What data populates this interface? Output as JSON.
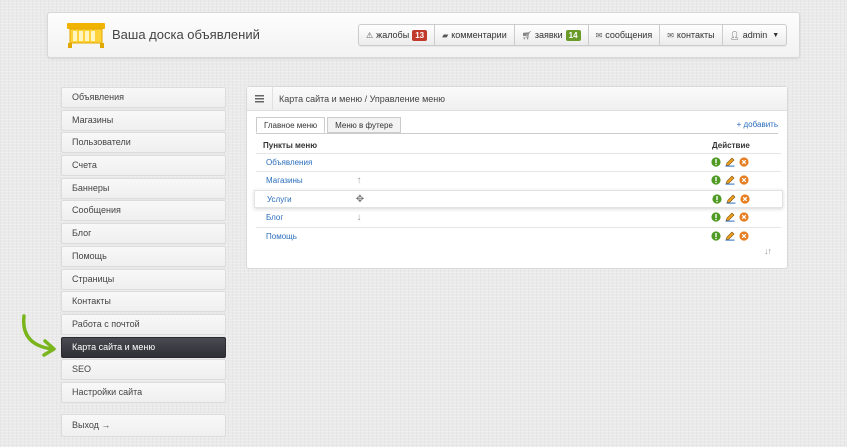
{
  "header": {
    "site_title": "Ваша доска объявлений",
    "nav": [
      {
        "label": "жалобы",
        "badge": "13",
        "badge_color": "#c0392b",
        "icon": "warning-icon"
      },
      {
        "label": "комментарии",
        "icon": "comment-icon"
      },
      {
        "label": "заявки",
        "badge": "14",
        "badge_color": "#6a9a2a",
        "icon": "cart-icon"
      },
      {
        "label": "сообщения",
        "icon": "envelope-icon"
      },
      {
        "label": "контакты",
        "icon": "envelope-icon"
      },
      {
        "label": "admin",
        "icon": "user-icon",
        "dropdown": true
      }
    ]
  },
  "sidebar": {
    "items": [
      {
        "label": "Объявления"
      },
      {
        "label": "Магазины"
      },
      {
        "label": "Пользователи"
      },
      {
        "label": "Счета"
      },
      {
        "label": "Баннеры"
      },
      {
        "label": "Сообщения"
      },
      {
        "label": "Блог"
      },
      {
        "label": "Помощь"
      },
      {
        "label": "Страницы"
      },
      {
        "label": "Контакты"
      },
      {
        "label": "Работа с почтой"
      },
      {
        "label": "Карта сайта и меню",
        "active": true
      },
      {
        "label": "SEO"
      },
      {
        "label": "Настройки сайта"
      }
    ],
    "logout": "Выход →"
  },
  "panel": {
    "breadcrumb": "Карта сайта и меню / Управление меню",
    "tabs": [
      {
        "label": "Главное меню",
        "active": true
      },
      {
        "label": "Меню в футере"
      }
    ],
    "add_label": "+ добавить",
    "col_items": "Пункты меню",
    "col_actions": "Действие",
    "rows": [
      {
        "label": "Объявления"
      },
      {
        "label": "Магазины",
        "move": "↑"
      },
      {
        "label": "Услуги",
        "move": "✥",
        "dragging": true
      },
      {
        "label": "Блог",
        "move": "↓"
      },
      {
        "label": "Помощь"
      }
    ],
    "sort_toggle": "↓↑"
  },
  "colors": {
    "accent_link": "#2a6ebd",
    "active_sidebar": "#35353c",
    "pointer_arrow": "#7ab51d",
    "action_enable": "#4f9a22",
    "action_delete": "#e67e22"
  }
}
